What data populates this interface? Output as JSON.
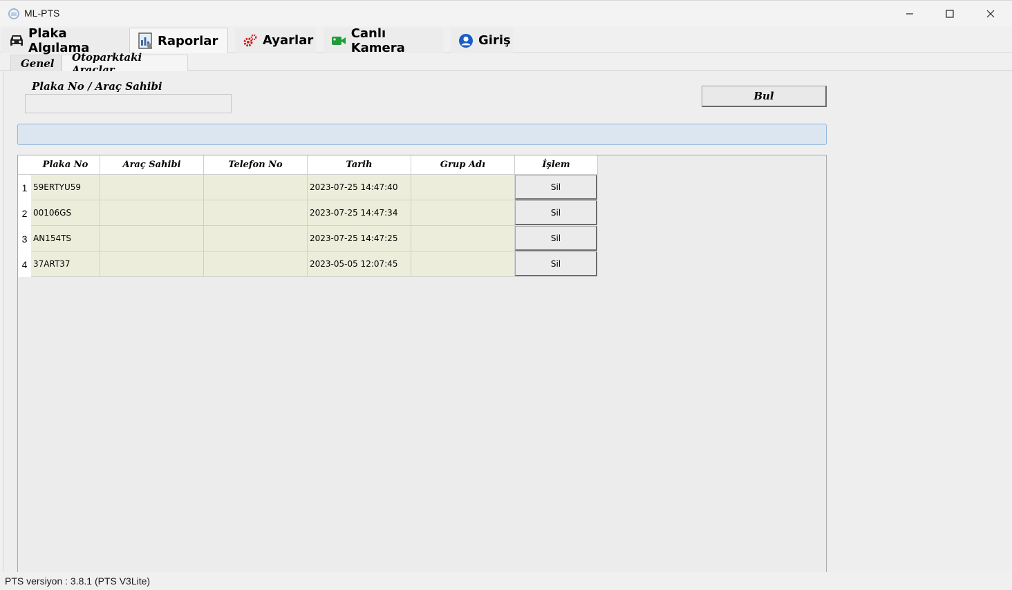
{
  "window": {
    "title": "ML-PTS"
  },
  "main_tabs": [
    {
      "label": "Plaka Algılama",
      "icon": "car-icon"
    },
    {
      "label": "Raporlar",
      "icon": "report-icon"
    },
    {
      "label": "Ayarlar",
      "icon": "gears-icon"
    },
    {
      "label": "Canlı Kamera",
      "icon": "video-camera-icon"
    },
    {
      "label": "Giriş",
      "icon": "user-icon"
    }
  ],
  "sub_tabs": [
    "Genel",
    "Otoparktaki Araçlar"
  ],
  "search": {
    "label": "Plaka No / Araç Sahibi",
    "value": "",
    "button_label": "Bul"
  },
  "progress": {
    "percent": 0
  },
  "table": {
    "columns": [
      "Plaka No",
      "Araç Sahibi",
      "Telefon No",
      "Tarih",
      "Grup Adı",
      "İşlem"
    ],
    "rows": [
      {
        "index": "1",
        "plate": "59ERTYU59",
        "owner": "",
        "phone": "",
        "date": "2023-07-25 14:47:40",
        "group": "",
        "action": "Sil"
      },
      {
        "index": "2",
        "plate": "00106GS",
        "owner": "",
        "phone": "",
        "date": "2023-07-25 14:47:34",
        "group": "",
        "action": "Sil"
      },
      {
        "index": "3",
        "plate": "AN154TS",
        "owner": "",
        "phone": "",
        "date": "2023-07-25 14:47:25",
        "group": "",
        "action": "Sil"
      },
      {
        "index": "4",
        "plate": "37ART37",
        "owner": "",
        "phone": "",
        "date": "2023-05-05 12:07:45",
        "group": "",
        "action": "Sil"
      }
    ]
  },
  "status": {
    "version_text": "PTS versiyon : 3.8.1 (PTS V3Lite)"
  },
  "colors": {
    "grid_cell": "#ededdc",
    "progress_fill": "#6aa0d8",
    "gears": "#d11a1a",
    "camera": "#1f9d3a",
    "user": "#1a5cc8"
  }
}
